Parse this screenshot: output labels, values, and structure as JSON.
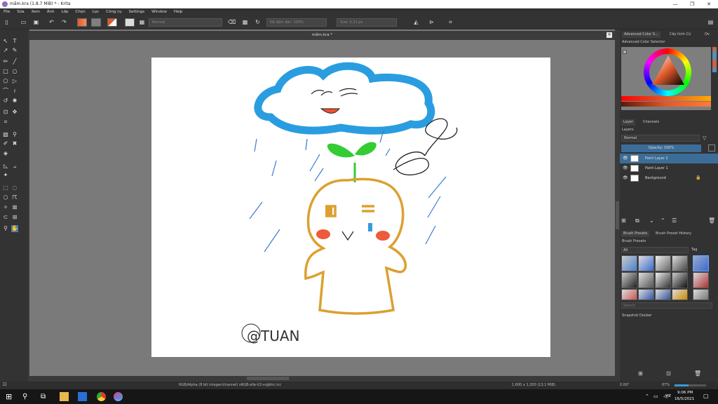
{
  "window": {
    "title": "mầm.kra (1.8.7 MiB)  * - Krita",
    "controls": {
      "minimize": "—",
      "maximize": "❐",
      "close": "✕"
    }
  },
  "menu": [
    "File",
    "Sửa",
    "Xem",
    "Ảnh",
    "Lớp",
    "Chọn",
    "Lọc",
    "Công cụ",
    "Settings",
    "Window",
    "Help"
  ],
  "toolbar": {
    "blend_mode": "Normal",
    "opacity": "Độ đậm đặc: 100%",
    "size": "Size: 3.21 px"
  },
  "document": {
    "tab_title": "mầm.kra *",
    "close": "✕",
    "signature": "@TUAN"
  },
  "dock": {
    "tabs_top": [
      "Advanced Color S...",
      "Cấy hình Cũ",
      "Ov"
    ],
    "color_selector_label": "Advanced Color Selector",
    "layers_tabs": [
      "Layer",
      "Channels"
    ],
    "layers_label": "Layers",
    "blend": "Normal",
    "opacity": "Opacity: 100%",
    "layers": [
      {
        "name": "Paint Layer 2",
        "selected": true
      },
      {
        "name": "Paint Layer 1",
        "selected": false
      },
      {
        "name": "Background",
        "selected": false
      }
    ],
    "brush_tabs": [
      "Brush Presets",
      "Brush Preset History"
    ],
    "brush_label": "Brush Presets",
    "brush_filter": "All",
    "brush_tag": "Tag",
    "search_placeholder": "Search",
    "snapshot_label": "Snapshot Docker"
  },
  "status": {
    "color_info": "RGB/Alpha (8 bit integer/channel)  sRGB-elle-V2-srgbtrc.icc",
    "dimensions": "1,600 x 1,200 (13.1 MiB)",
    "rotation": "0.00°",
    "zoom": "67%"
  },
  "taskbar": {
    "time": "9:06 PM",
    "date": "16/5/2021",
    "lang": "VIE"
  },
  "colors": {
    "accent_blue": "#3a9ad9",
    "cloud_blue": "#2a9de0",
    "sprout_green": "#33cc33",
    "body_orange": "#dca030",
    "cheek_red": "#ee5a3a",
    "selection_blue": "#3c6d99",
    "fg_color": "#e05a2a"
  }
}
